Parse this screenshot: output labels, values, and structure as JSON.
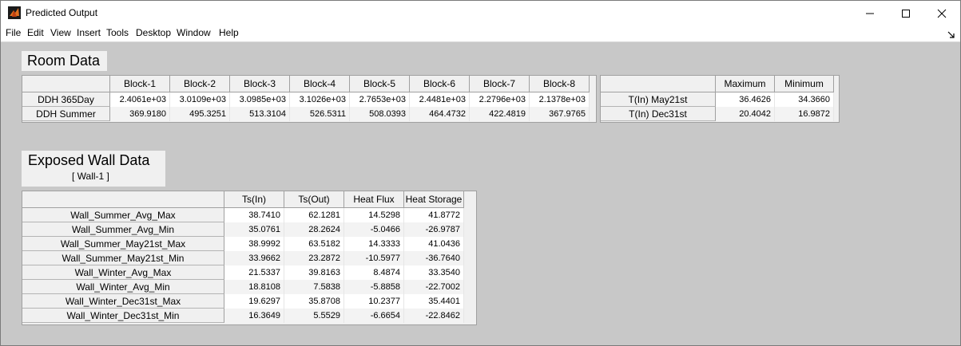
{
  "window": {
    "title": "Predicted Output"
  },
  "menu": [
    {
      "label": "File"
    },
    {
      "label": "Edit"
    },
    {
      "label": "View"
    },
    {
      "label": "Insert"
    },
    {
      "label": "Tools"
    },
    {
      "label": "Desktop"
    },
    {
      "label": "Window"
    },
    {
      "label": "Help"
    }
  ],
  "room_data": {
    "title": "Room Data",
    "columns": [
      "Block-1",
      "Block-2",
      "Block-3",
      "Block-4",
      "Block-5",
      "Block-6",
      "Block-7",
      "Block-8"
    ],
    "rows": [
      {
        "label": "DDH 365Day",
        "values": [
          "2.4061e+03",
          "3.0109e+03",
          "3.0985e+03",
          "3.1026e+03",
          "2.7653e+03",
          "2.4481e+03",
          "2.2796e+03",
          "2.1378e+03"
        ]
      },
      {
        "label": "DDH Summer",
        "values": [
          "369.9180",
          "495.3251",
          "513.3104",
          "526.5311",
          "508.0393",
          "464.4732",
          "422.4819",
          "367.9765"
        ]
      }
    ],
    "temp_columns": [
      "Maximum",
      "Minimum"
    ],
    "temp_rows": [
      {
        "label": "T(In) May21st",
        "values": [
          "36.4626",
          "34.3660"
        ]
      },
      {
        "label": "T(In) Dec31st",
        "values": [
          "20.4042",
          "16.9872"
        ]
      }
    ]
  },
  "wall_data": {
    "title": "Exposed Wall Data",
    "subtitle": "[ Wall-1 ]",
    "columns": [
      "Ts(In)",
      "Ts(Out)",
      "Heat Flux",
      "Heat Storage"
    ],
    "rows": [
      {
        "label": "Wall_Summer_Avg_Max",
        "values": [
          "38.7410",
          "62.1281",
          "14.5298",
          "41.8772"
        ]
      },
      {
        "label": "Wall_Summer_Avg_Min",
        "values": [
          "35.0761",
          "28.2624",
          "-5.0466",
          "-26.9787"
        ]
      },
      {
        "label": "Wall_Summer_May21st_Max",
        "values": [
          "38.9992",
          "63.5182",
          "14.3333",
          "41.0436"
        ]
      },
      {
        "label": "Wall_Summer_May21st_Min",
        "values": [
          "33.9662",
          "23.2872",
          "-10.5977",
          "-36.7640"
        ]
      },
      {
        "label": "Wall_Winter_Avg_Max",
        "values": [
          "21.5337",
          "39.8163",
          "8.4874",
          "33.3540"
        ]
      },
      {
        "label": "Wall_Winter_Avg_Min",
        "values": [
          "18.8108",
          "7.5838",
          "-5.8858",
          "-22.7002"
        ]
      },
      {
        "label": "Wall_Winter_Dec31st_Max",
        "values": [
          "19.6297",
          "35.8708",
          "10.2377",
          "35.4401"
        ]
      },
      {
        "label": "Wall_Winter_Dec31st_Min",
        "values": [
          "16.3649",
          "5.5529",
          "-6.6654",
          "-22.8462"
        ]
      }
    ]
  }
}
